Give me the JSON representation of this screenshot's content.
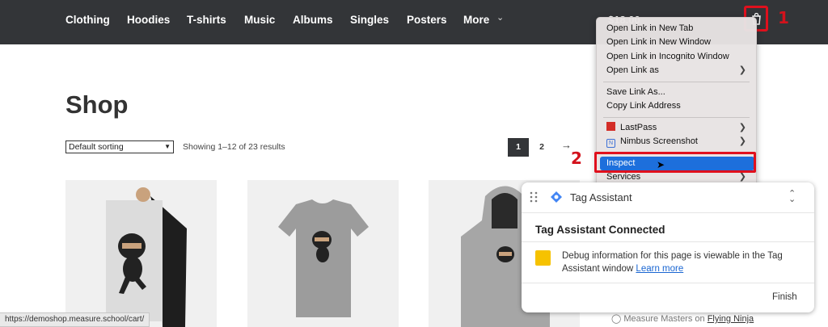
{
  "nav": {
    "items": [
      "Clothing",
      "Hoodies",
      "T-shirts",
      "Music",
      "Albums",
      "Singles",
      "Posters",
      "More"
    ],
    "cart_amount": "$18.00"
  },
  "markers": {
    "one": "1",
    "two": "2"
  },
  "shop": {
    "title": "Shop",
    "sort_value": "Default sorting",
    "results_text": "Showing 1–12 of 23 results",
    "pages": [
      "1",
      "2"
    ],
    "next": "→"
  },
  "status_bar": {
    "url": "https://demoshop.measure.school/cart/"
  },
  "review": {
    "prefix": "Measure Masters on",
    "product": "Flying Ninja"
  },
  "context_menu": {
    "items": [
      "Open Link in New Tab",
      "Open Link in New Window",
      "Open Link in Incognito Window",
      "Open Link as",
      "Save Link As...",
      "Copy Link Address",
      "LastPass",
      "Nimbus Screenshot",
      "Inspect",
      "Services"
    ]
  },
  "tag_assistant": {
    "title": "Tag Assistant",
    "status": "Tag Assistant Connected",
    "debug_text": "Debug information for this page is viewable in the Tag Assistant window",
    "learn_more": "Learn more",
    "finish": "Finish"
  },
  "colors": {
    "nav_bg": "#333538",
    "highlight": "#e0101d",
    "inspect_bg": "#1d6fdc",
    "debug_icon": "#f6c200"
  }
}
